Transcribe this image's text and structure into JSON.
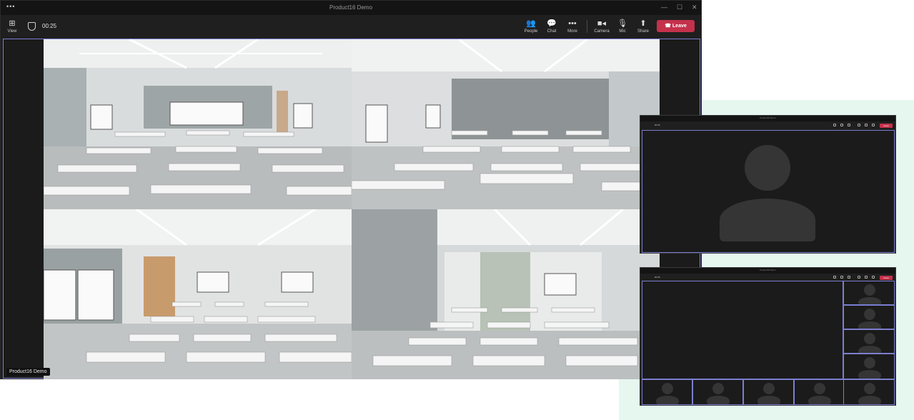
{
  "window": {
    "title": "Product16 Demo",
    "menu_glyph": "•••",
    "controls": {
      "minimize": "—",
      "maximize": "☐",
      "close": "✕"
    }
  },
  "toolbar": {
    "view_label": "View",
    "timer": "00:25",
    "people_label": "People",
    "chat_label": "Chat",
    "more_label": "More",
    "camera_label": "Camera",
    "mic_label": "Mic",
    "share_label": "Share",
    "leave_label": "Leave"
  },
  "icons": {
    "view": "grid-icon",
    "shield": "shield-icon",
    "people": "people-icon",
    "chat": "chat-icon",
    "more": "more-icon",
    "camera": "camera-icon",
    "mic": "mic-icon",
    "share": "share-icon",
    "leave": "phone-hangup-icon"
  },
  "stage": {
    "participant_name": "Product16 Demo",
    "tiles": [
      "classroom-front-left",
      "classroom-front-right",
      "classroom-rear-left",
      "classroom-rear-right"
    ]
  },
  "mini_window_1": {
    "title": "Product16 Demo",
    "timer": "00:25",
    "leave_label": "Leave",
    "layout": "single-avatar"
  },
  "mini_window_2": {
    "title": "Product16 Demo",
    "timer": "00:25",
    "leave_label": "Leave",
    "layout": "gallery"
  },
  "colors": {
    "leave": "#c4314b",
    "accent_border": "#7b7fd0",
    "window_bg": "#1f1f1f",
    "background_accent": "#e6f7f0"
  }
}
